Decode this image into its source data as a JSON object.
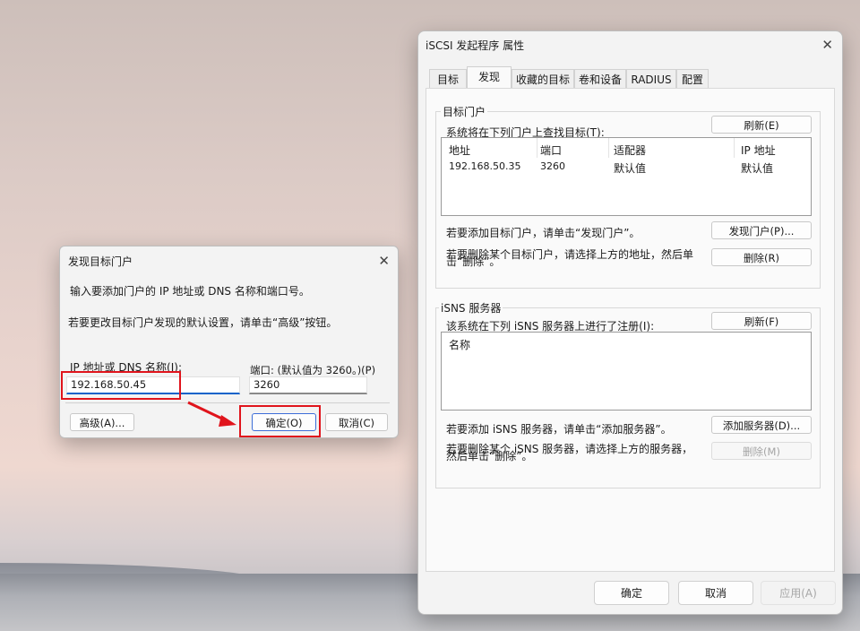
{
  "main_dialog": {
    "title": "iSCSI 发起程序 属性",
    "tabs": [
      "目标",
      "发现",
      "收藏的目标",
      "卷和设备",
      "RADIUS",
      "配置"
    ],
    "active_tab": "发现",
    "target_portals": {
      "group_label": "目标门户",
      "description": "系统将在下列门户上查找目标(T):",
      "refresh_button": "刷新(E)",
      "columns": [
        "地址",
        "端口",
        "适配器",
        "IP 地址"
      ],
      "rows": [
        {
          "address": "192.168.50.35",
          "port": "3260",
          "adapter": "默认值",
          "ip": "默认值"
        }
      ],
      "add_hint": "若要添加目标门户，请单击“发现门户”。",
      "discover_button": "发现门户(P)...",
      "remove_hint_line1": "若要删除某个目标门户，请选择上方的地址，然后单",
      "remove_hint_line2": "击“删除”。",
      "remove_button": "删除(R)"
    },
    "isns": {
      "group_label": "iSNS 服务器",
      "description": "该系统在下列 iSNS 服务器上进行了注册(I):",
      "refresh_button": "刷新(F)",
      "columns": [
        "名称"
      ],
      "add_hint": "若要添加 iSNS 服务器，请单击“添加服务器”。",
      "add_button": "添加服务器(D)...",
      "remove_hint_line1": "若要删除某个 iSNS 服务器，请选择上方的服务器，",
      "remove_hint_line2": "然后单击“删除”。",
      "remove_button": "删除(M)"
    },
    "footer": {
      "ok": "确定",
      "cancel": "取消",
      "apply": "应用(A)"
    }
  },
  "discover_dialog": {
    "title": "发现目标门户",
    "instruction": "输入要添加门户的 IP 地址或 DNS 名称和端口号。",
    "advanced_hint": "若要更改目标门户发现的默认设置，请单击“高级”按钮。",
    "ip_label": "IP 地址或 DNS 名称(I):",
    "ip_value": "192.168.50.45",
    "port_label": "端口: (默认值为 3260。)(P)",
    "port_value": "3260",
    "advanced_button": "高级(A)...",
    "ok_button": "确定(O)",
    "cancel_button": "取消(C)"
  },
  "colors": {
    "highlight_box": "#e0141c",
    "arrow": "#e0141c",
    "focus_underline": "#0e63c9"
  }
}
